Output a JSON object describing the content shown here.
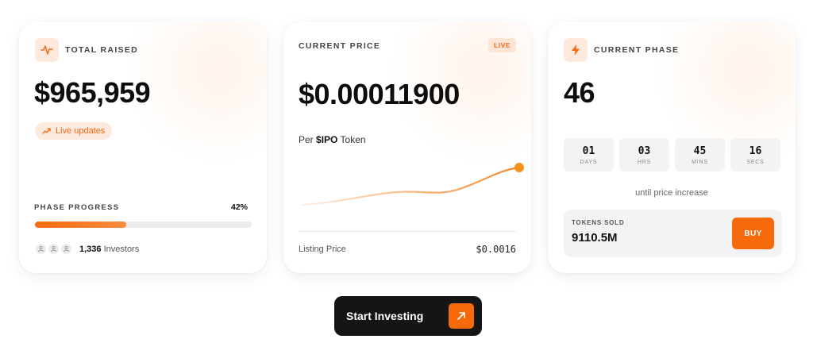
{
  "raised": {
    "label": "TOTAL RAISED",
    "icon": "activity-pulse-icon",
    "amount": "$965,959",
    "live_pill": "Live updates",
    "phase_progress_label": "PHASE PROGRESS",
    "phase_progress_percent": "42%",
    "phase_progress_value": 0.42,
    "investors_count": "1,336",
    "investors_label": "Investors"
  },
  "price": {
    "label": "CURRENT PRICE",
    "live_badge": "LIVE",
    "amount": "$0.00011900",
    "per_prefix": "Per",
    "token_symbol": "$IPO",
    "token_suffix": "Token",
    "listing_label": "Listing Price",
    "listing_value": "$0.0016"
  },
  "phase": {
    "label": "CURRENT PHASE",
    "icon": "lightning-bolt-icon",
    "number": "46",
    "countdown": [
      {
        "value": "01",
        "unit": "DAYS"
      },
      {
        "value": "03",
        "unit": "HRS"
      },
      {
        "value": "45",
        "unit": "MINS"
      },
      {
        "value": "16",
        "unit": "SECS"
      }
    ],
    "until_text": "until price increase",
    "tokens_sold_label": "TOKENS SOLD",
    "tokens_sold_value": "9110.5M",
    "buy_label": "BUY"
  },
  "cta": {
    "label": "Start Investing",
    "icon": "arrow-up-right-icon"
  },
  "colors": {
    "accent": "#f66a0c",
    "accent_soft": "#fde9dc",
    "dark": "#151515"
  }
}
